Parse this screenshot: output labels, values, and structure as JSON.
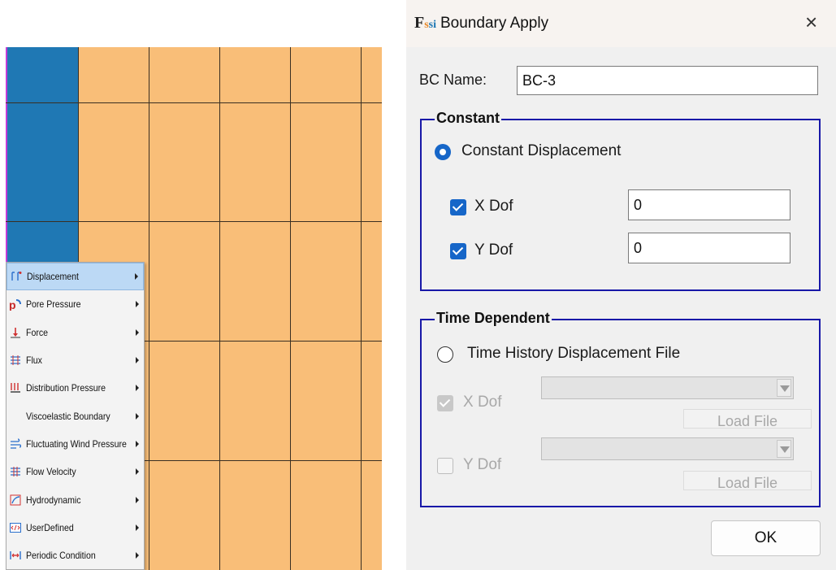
{
  "dialog": {
    "title": "Boundary Apply",
    "app_icon_text": "FSSI",
    "close_glyph": "×",
    "bc_name_label": "BC Name:",
    "bc_name_value": "BC-3",
    "constant": {
      "title": "Constant",
      "radio_label": "Constant Displacement",
      "radio_selected": true,
      "x_dof_label": "X Dof",
      "x_dof_checked": true,
      "x_dof_value": "0",
      "y_dof_label": "Y Dof",
      "y_dof_checked": true,
      "y_dof_value": "0"
    },
    "time_dependent": {
      "title": "Time Dependent",
      "radio_label": "Time History Displacement File",
      "radio_selected": false,
      "x_dof_label": "X Dof",
      "x_dof_checked": true,
      "y_dof_label": "Y Dof",
      "y_dof_checked": false,
      "load_file_label": "Load File"
    },
    "ok_label": "OK"
  },
  "context_menu": {
    "items": [
      {
        "label": "Displacement",
        "icon": "displacement-icon",
        "highlighted": true
      },
      {
        "label": "Pore Pressure",
        "icon": "pore-pressure-icon"
      },
      {
        "label": "Force",
        "icon": "force-icon"
      },
      {
        "label": "Flux",
        "icon": "flux-icon"
      },
      {
        "label": "Distribution Pressure",
        "icon": "distribution-pressure-icon"
      },
      {
        "label": "Viscoelastic Boundary",
        "icon": ""
      },
      {
        "label": "Fluctuating Wind Pressure",
        "icon": "wind-pressure-icon"
      },
      {
        "label": "Flow Velocity",
        "icon": "flow-velocity-icon"
      },
      {
        "label": "Hydrodynamic",
        "icon": "hydrodynamic-icon"
      },
      {
        "label": "UserDefined",
        "icon": "user-defined-icon"
      },
      {
        "label": "Periodic Condition",
        "icon": "periodic-condition-icon"
      }
    ]
  },
  "colors": {
    "mesh_fill": "#f9be78",
    "mesh_selected": "#1f78b4",
    "group_border": "#1818a8",
    "accent": "#1666c8"
  }
}
